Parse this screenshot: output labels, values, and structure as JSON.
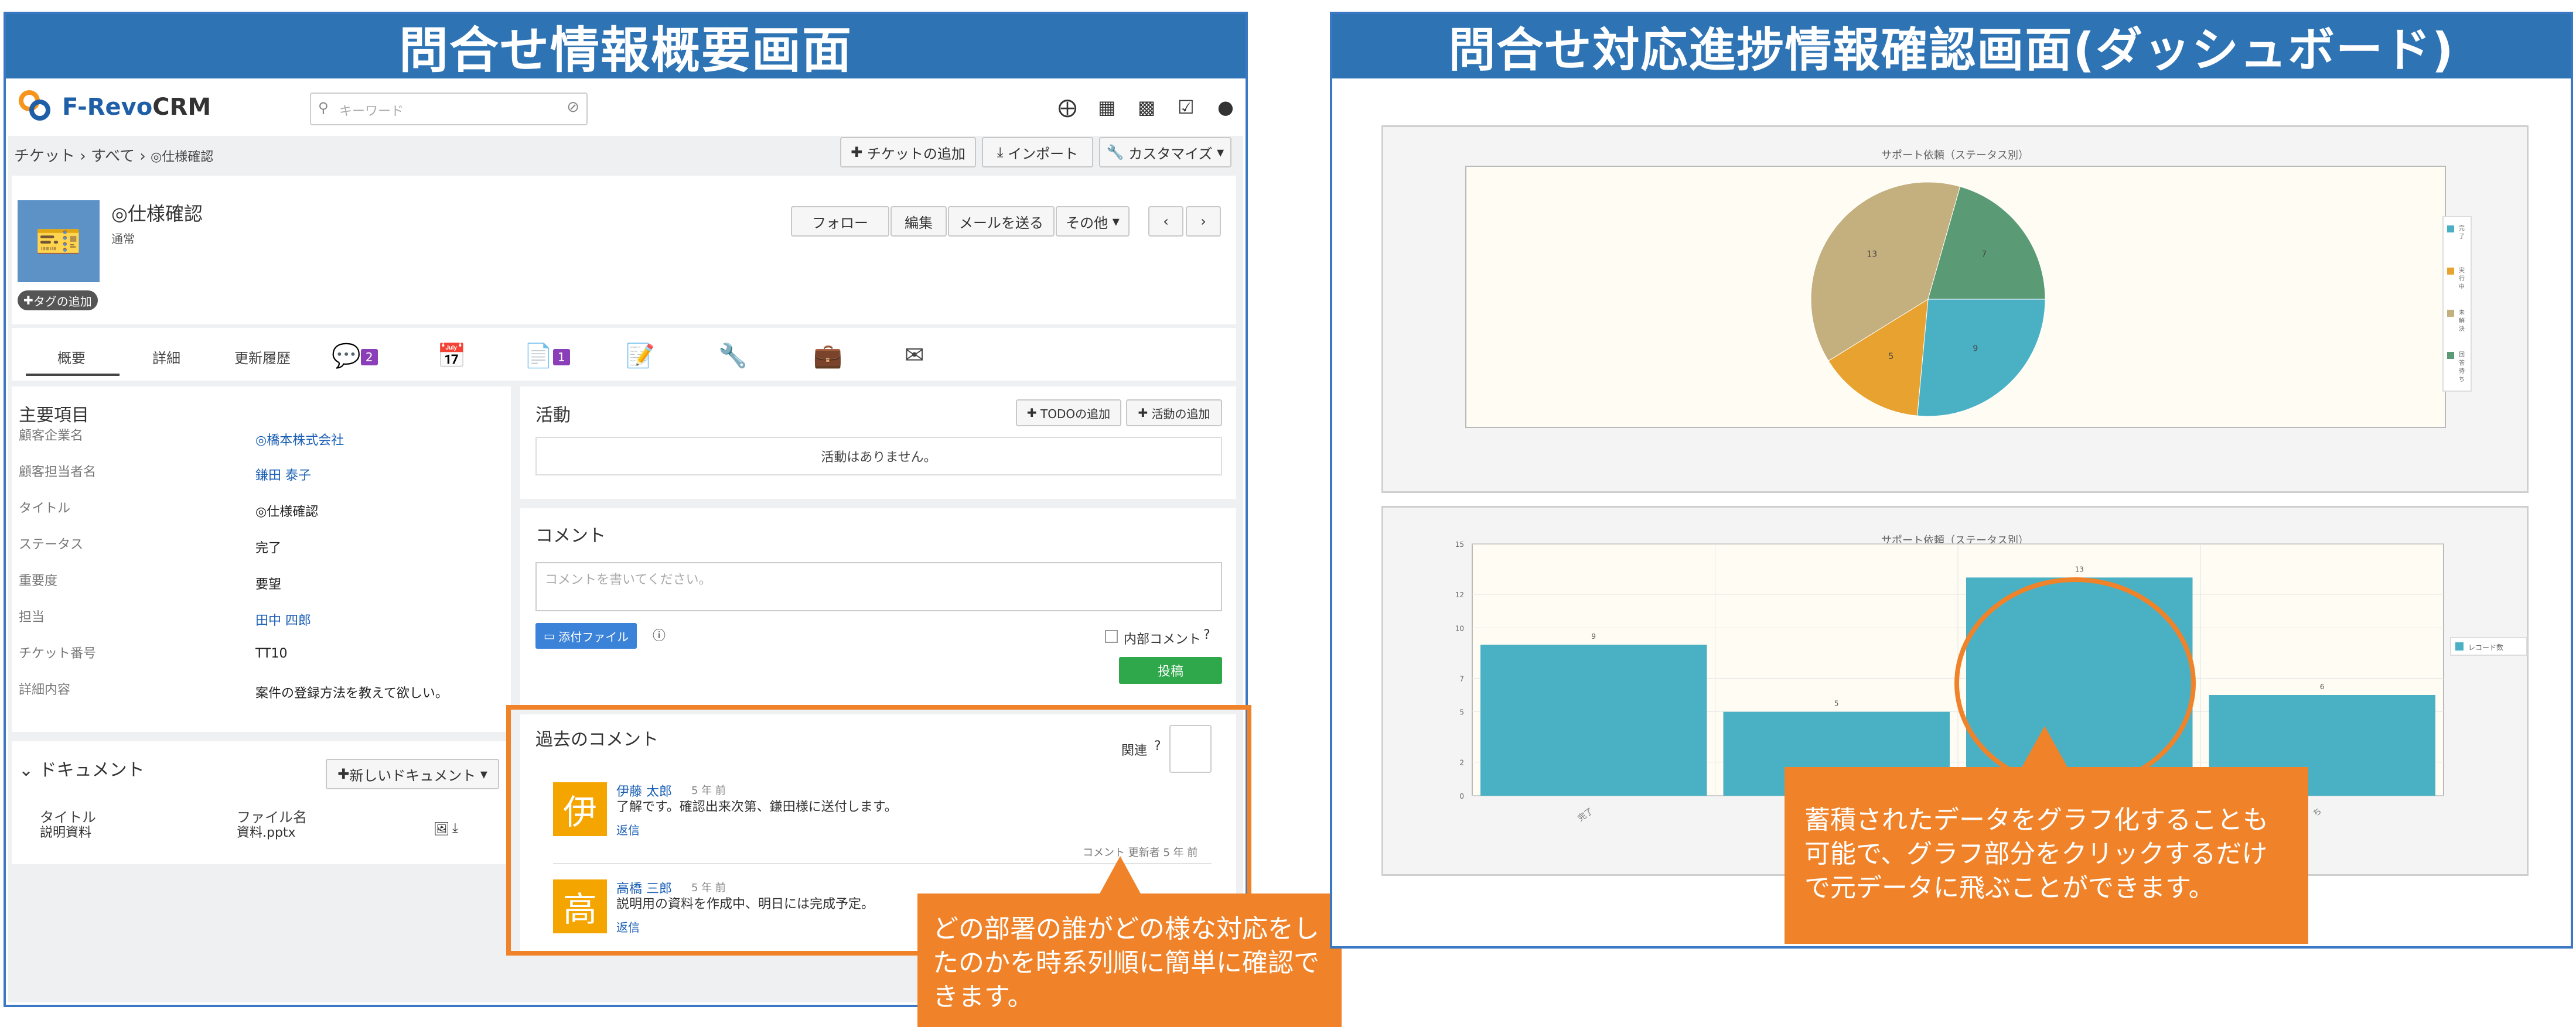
{
  "left_panel": {
    "title": "問合せ情報概要画面",
    "app": {
      "logo_a": "F-Revo",
      "logo_b": "CRM"
    },
    "search_placeholder": "キーワード",
    "breadcrumb": {
      "item1": "チケット",
      "item2": "すべて",
      "item3": "◎仕様確認"
    },
    "toolbar": {
      "add_ticket": "チケットの追加",
      "import": "インポート",
      "customize": "カスタマイズ"
    },
    "record": {
      "name": "◎仕様確認",
      "sub": "通常",
      "tag_add": "タグの追加"
    },
    "actions": {
      "follow": "フォロー",
      "edit": "編集",
      "send_mail": "メールを送る",
      "other": "その他"
    },
    "tabs": {
      "summary": "概要",
      "detail": "詳細",
      "history": "更新履歴",
      "comment_count": "2",
      "doc_count": "1"
    },
    "main_items": {
      "heading": "主要項目",
      "rows": [
        {
          "label": "顧客企業名",
          "value": "◎橋本株式会社"
        },
        {
          "label": "顧客担当者名",
          "value": "鎌田 泰子"
        },
        {
          "label": "タイトル",
          "value": "◎仕様確認"
        },
        {
          "label": "ステータス",
          "value": "完了"
        },
        {
          "label": "重要度",
          "value": "要望"
        },
        {
          "label": "担当",
          "value": "田中 四郎"
        },
        {
          "label": "チケット番号",
          "value": "TT10"
        },
        {
          "label": "詳細内容",
          "value": "案件の登録方法を教えて欲しい。"
        }
      ]
    },
    "activity": {
      "heading": "活動",
      "add_todo": "TODOの追加",
      "add_activity": "活動の追加",
      "empty": "活動はありません。"
    },
    "comment": {
      "heading": "コメント",
      "placeholder": "コメントを書いてください。",
      "attach": "添付ファイル",
      "internal": "内部コメント",
      "post": "投稿"
    },
    "documents": {
      "heading": "ドキュメント",
      "new_doc": "新しいドキュメント",
      "col_title": "タイトル",
      "col_file": "ファイル名",
      "doc_title": "説明資料",
      "doc_file": "資料.pptx"
    },
    "past_comments": {
      "heading": "過去のコメント",
      "related": "関連",
      "items": [
        {
          "avatar": "伊",
          "author": "伊藤 太郎",
          "time": "5 年 前",
          "text": "了解です。確認出来次第、鎌田様に送付します。",
          "reply": "返信"
        },
        {
          "avatar": "高",
          "author": "高橋 三郎",
          "time": "5 年 前",
          "text": "説明用の資料を作成中、明日には完成予定。",
          "reply": "返信"
        }
      ],
      "updated": "コメント 更新者 5 年 前"
    },
    "callout": "どの部署の誰がどの様な対応をしたのかを時系列順に簡単に確認できます。"
  },
  "right_panel": {
    "title": "問合せ対応進捗情報確認画面(ダッシュボード)",
    "callout": "蓄積されたデータをグラフ化することも可能で、グラフ部分をクリックするだけで元データに飛ぶことができます。"
  },
  "colors": {
    "accent": "#2e74b5",
    "orange": "#f0832a",
    "teal": "#4ab1c4",
    "gold": "#e8a22f",
    "khaki": "#c4b07e",
    "green": "#5a9a74"
  },
  "chart_data": [
    {
      "type": "pie",
      "title": "サポート依頼（ステータス別）",
      "categories": [
        "完了",
        "実行中",
        "未解決",
        "回答待ち"
      ],
      "values": [
        9,
        5,
        13,
        7
      ],
      "legend_position": "right"
    },
    {
      "type": "bar",
      "title": "サポート依頼（ステータス別）",
      "categories": [
        "完了",
        "",
        "",
        "ち"
      ],
      "series": [
        {
          "name": "レコード数",
          "values": [
            9,
            5,
            13,
            6
          ]
        }
      ],
      "ylim": [
        0,
        15
      ],
      "yticks": [
        0,
        2,
        5,
        7,
        10,
        12,
        15
      ],
      "grid": true,
      "legend_position": "right"
    }
  ]
}
